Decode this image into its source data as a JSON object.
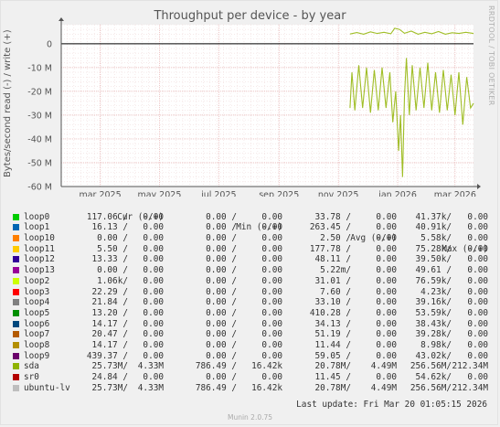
{
  "title": "Throughput per device - by year",
  "watermark": "RRDTOOL / TOBI OETIKER",
  "ylabel": "Bytes/second read (-) / write (+)",
  "footer": "Munin 2.0.75",
  "last_update": "Last update: Fri Mar 20 01:05:15 2026",
  "legend_header": {
    "cur": "Cur (-/+)",
    "min": "Min (-/+)",
    "avg": "Avg (-/+)",
    "max": "Max (-/+)"
  },
  "legend": [
    {
      "name": "loop0",
      "color": "#00cc00",
      "cur": [
        "117.06",
        "0.00"
      ],
      "min": [
        "0.00",
        "0.00"
      ],
      "avg": [
        "33.78",
        "0.00"
      ],
      "max": [
        "41.37k",
        "0.00"
      ]
    },
    {
      "name": "loop1",
      "color": "#0066b3",
      "cur": [
        "16.13",
        "0.00"
      ],
      "min": [
        "0.00",
        "0.00"
      ],
      "avg": [
        "263.45",
        "0.00"
      ],
      "max": [
        "40.91k",
        "0.00"
      ]
    },
    {
      "name": "loop10",
      "color": "#ff8000",
      "cur": [
        "0.00",
        "0.00"
      ],
      "min": [
        "0.00",
        "0.00"
      ],
      "avg": [
        "2.50",
        "0.00"
      ],
      "max": [
        "5.58k",
        "0.00"
      ]
    },
    {
      "name": "loop11",
      "color": "#ffcc00",
      "cur": [
        "5.50",
        "0.00"
      ],
      "min": [
        "0.00",
        "0.00"
      ],
      "avg": [
        "177.78",
        "0.00"
      ],
      "max": [
        "75.28k",
        "0.00"
      ]
    },
    {
      "name": "loop12",
      "color": "#330099",
      "cur": [
        "13.33",
        "0.00"
      ],
      "min": [
        "0.00",
        "0.00"
      ],
      "avg": [
        "48.11",
        "0.00"
      ],
      "max": [
        "39.50k",
        "0.00"
      ]
    },
    {
      "name": "loop13",
      "color": "#990099",
      "cur": [
        "0.00",
        "0.00"
      ],
      "min": [
        "0.00",
        "0.00"
      ],
      "avg": [
        "5.22m",
        "0.00"
      ],
      "max": [
        "49.61",
        "0.00"
      ]
    },
    {
      "name": "loop2",
      "color": "#ccff00",
      "cur": [
        "1.06k",
        "0.00"
      ],
      "min": [
        "0.00",
        "0.00"
      ],
      "avg": [
        "31.01",
        "0.00"
      ],
      "max": [
        "76.59k",
        "0.00"
      ]
    },
    {
      "name": "loop3",
      "color": "#ff0000",
      "cur": [
        "22.29",
        "0.00"
      ],
      "min": [
        "0.00",
        "0.00"
      ],
      "avg": [
        "7.60",
        "0.00"
      ],
      "max": [
        "4.23k",
        "0.00"
      ]
    },
    {
      "name": "loop4",
      "color": "#808080",
      "cur": [
        "21.84",
        "0.00"
      ],
      "min": [
        "0.00",
        "0.00"
      ],
      "avg": [
        "33.10",
        "0.00"
      ],
      "max": [
        "39.16k",
        "0.00"
      ]
    },
    {
      "name": "loop5",
      "color": "#008f00",
      "cur": [
        "13.20",
        "0.00"
      ],
      "min": [
        "0.00",
        "0.00"
      ],
      "avg": [
        "410.28",
        "0.00"
      ],
      "max": [
        "53.59k",
        "0.00"
      ]
    },
    {
      "name": "loop6",
      "color": "#00487d",
      "cur": [
        "14.17",
        "0.00"
      ],
      "min": [
        "0.00",
        "0.00"
      ],
      "avg": [
        "34.13",
        "0.00"
      ],
      "max": [
        "38.43k",
        "0.00"
      ]
    },
    {
      "name": "loop7",
      "color": "#b35a00",
      "cur": [
        "20.47",
        "0.00"
      ],
      "min": [
        "0.00",
        "0.00"
      ],
      "avg": [
        "51.19",
        "0.00"
      ],
      "max": [
        "39.28k",
        "0.00"
      ]
    },
    {
      "name": "loop8",
      "color": "#b38f00",
      "cur": [
        "14.17",
        "0.00"
      ],
      "min": [
        "0.00",
        "0.00"
      ],
      "avg": [
        "11.44",
        "0.00"
      ],
      "max": [
        "8.98k",
        "0.00"
      ]
    },
    {
      "name": "loop9",
      "color": "#6b006b",
      "cur": [
        "439.37",
        "0.00"
      ],
      "min": [
        "0.00",
        "0.00"
      ],
      "avg": [
        "59.05",
        "0.00"
      ],
      "max": [
        "43.02k",
        "0.00"
      ]
    },
    {
      "name": "sda",
      "color": "#8fb300",
      "cur": [
        "25.73M",
        "4.33M"
      ],
      "min": [
        "786.49",
        "16.42k"
      ],
      "avg": [
        "20.78M",
        "4.49M"
      ],
      "max": [
        "256.56M",
        "212.34M"
      ]
    },
    {
      "name": "sr0",
      "color": "#b30000",
      "cur": [
        "24.84",
        "0.00"
      ],
      "min": [
        "0.00",
        "0.00"
      ],
      "avg": [
        "11.45",
        "0.00"
      ],
      "max": [
        "54.62k",
        "0.00"
      ]
    },
    {
      "name": "ubuntu-lv",
      "color": "#bebebe",
      "cur": [
        "25.73M",
        "4.33M"
      ],
      "min": [
        "786.49",
        "16.42k"
      ],
      "avg": [
        "20.78M",
        "4.49M"
      ],
      "max": [
        "256.56M",
        "212.34M"
      ]
    }
  ],
  "chart_data": {
    "type": "line",
    "title": "Throughput per device - by year",
    "ylabel": "Bytes/second read (-) / write (+)",
    "y_unit": "bytes/second",
    "ylim": [
      -60000000,
      8000000
    ],
    "yticks": [
      0,
      -10000000,
      -20000000,
      -30000000,
      -40000000,
      -50000000,
      -60000000
    ],
    "ytick_labels": [
      "0",
      "-10 M",
      "-20 M",
      "-30 M",
      "-40 M",
      "-50 M",
      "-60 M"
    ],
    "xlim": [
      "2025-01-20",
      "2026-03-20"
    ],
    "xticks": [
      "2025-03-01",
      "2025-05-01",
      "2025-07-01",
      "2025-09-01",
      "2025-11-01",
      "2026-01-01",
      "2026-03-01"
    ],
    "xtick_labels": [
      "mar 2025",
      "may 2025",
      "jul 2025",
      "sep 2025",
      "nov 2025",
      "jan 2026",
      "mar 2026"
    ],
    "grid": true,
    "series": [
      {
        "name": "sda",
        "color": "#8fb300",
        "write": [
          [
            "2025-11-13",
            4100000
          ],
          [
            "2025-11-20",
            4700000
          ],
          [
            "2025-11-27",
            4000000
          ],
          [
            "2025-12-04",
            5000000
          ],
          [
            "2025-12-11",
            4300000
          ],
          [
            "2025-12-18",
            4800000
          ],
          [
            "2025-12-25",
            4200000
          ],
          [
            "2025-12-29",
            6500000
          ],
          [
            "2026-01-03",
            6000000
          ],
          [
            "2026-01-08",
            4400000
          ],
          [
            "2026-01-15",
            5300000
          ],
          [
            "2026-01-22",
            4000000
          ],
          [
            "2026-01-29",
            4800000
          ],
          [
            "2026-02-05",
            4200000
          ],
          [
            "2026-02-12",
            5100000
          ],
          [
            "2026-02-19",
            4000000
          ],
          [
            "2026-02-26",
            4600000
          ],
          [
            "2026-03-05",
            4300000
          ],
          [
            "2026-03-12",
            4800000
          ],
          [
            "2026-03-20",
            4300000
          ]
        ],
        "read": [
          [
            "2025-11-13",
            -27000000
          ],
          [
            "2025-11-15",
            -12000000
          ],
          [
            "2025-11-18",
            -28000000
          ],
          [
            "2025-11-22",
            -9000000
          ],
          [
            "2025-11-26",
            -27000000
          ],
          [
            "2025-11-30",
            -10000000
          ],
          [
            "2025-12-04",
            -29000000
          ],
          [
            "2025-12-08",
            -11000000
          ],
          [
            "2025-12-12",
            -28000000
          ],
          [
            "2025-12-16",
            -10000000
          ],
          [
            "2025-12-20",
            -27000000
          ],
          [
            "2025-12-24",
            -12000000
          ],
          [
            "2025-12-27",
            -33000000
          ],
          [
            "2025-12-30",
            -20000000
          ],
          [
            "2026-01-02",
            -45000000
          ],
          [
            "2026-01-04",
            -30000000
          ],
          [
            "2026-01-06",
            -56000000
          ],
          [
            "2026-01-08",
            -22000000
          ],
          [
            "2026-01-10",
            -6000000
          ],
          [
            "2026-01-13",
            -30000000
          ],
          [
            "2026-01-16",
            -9000000
          ],
          [
            "2026-01-20",
            -28000000
          ],
          [
            "2026-01-24",
            -10000000
          ],
          [
            "2026-01-28",
            -27000000
          ],
          [
            "2026-02-01",
            -8000000
          ],
          [
            "2026-02-05",
            -28000000
          ],
          [
            "2026-02-09",
            -12000000
          ],
          [
            "2026-02-13",
            -29000000
          ],
          [
            "2026-02-17",
            -11000000
          ],
          [
            "2026-02-21",
            -28000000
          ],
          [
            "2026-02-25",
            -13000000
          ],
          [
            "2026-03-01",
            -30000000
          ],
          [
            "2026-03-05",
            -12000000
          ],
          [
            "2026-03-09",
            -34000000
          ],
          [
            "2026-03-13",
            -14000000
          ],
          [
            "2026-03-17",
            -27000000
          ],
          [
            "2026-03-20",
            -25000000
          ]
        ]
      }
    ]
  }
}
